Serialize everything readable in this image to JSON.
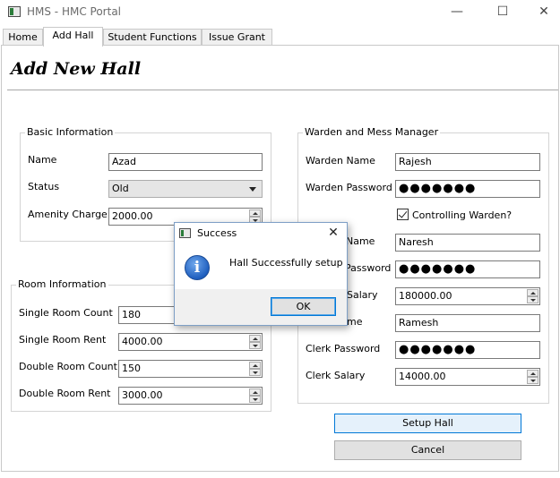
{
  "window": {
    "title": "HMS - HMC Portal",
    "icon": "app-window-icon",
    "minimize_glyph": "—",
    "maximize_glyph": "☐",
    "close_glyph": "✕"
  },
  "tabs": [
    {
      "label": "Home",
      "active": false
    },
    {
      "label": "Add Hall",
      "active": true
    },
    {
      "label": "Student Functions",
      "active": false
    },
    {
      "label": "Issue Grant",
      "active": false
    }
  ],
  "page": {
    "title": "Add New Hall"
  },
  "basic_info": {
    "title": "Basic Information",
    "name_label": "Name",
    "name_value": "Azad",
    "status_label": "Status",
    "status_value": "Old",
    "amenity_label": "Amenity Charge",
    "amenity_value": "2000.00"
  },
  "room_info": {
    "title": "Room Information",
    "single_count_label": "Single Room Count",
    "single_count_value": "180",
    "single_rent_label": "Single Room Rent",
    "single_rent_value": "4000.00",
    "double_count_label": "Double Room Count",
    "double_count_value": "150",
    "double_rent_label": "Double Room Rent",
    "double_rent_value": "3000.00"
  },
  "warden_info": {
    "title": "Warden and Mess Manager",
    "warden_name_label": "Warden Name",
    "warden_name_value": "Rajesh",
    "warden_password_label": "Warden Password",
    "warden_password_value": "●●●●●●●",
    "controlling_label": "Controlling Warden?",
    "controlling_checked": true,
    "mess_name_label": "Name",
    "mess_name_value": "Naresh",
    "mess_password_label": "Password",
    "mess_password_value": "●●●●●●●",
    "mess_salary_label": "Salary",
    "mess_salary_value": "180000.00",
    "clerk_name_label": "me",
    "clerk_name_value": "Ramesh",
    "clerk_password_label": "Clerk Password",
    "clerk_password_value": "●●●●●●●",
    "clerk_salary_label": "Clerk Salary",
    "clerk_salary_value": "14000.00"
  },
  "actions": {
    "setup_label": "Setup Hall",
    "cancel_label": "Cancel"
  },
  "dialog": {
    "title": "Success",
    "message": "Hall Successfully setup",
    "ok_label": "OK",
    "icon": "info-icon",
    "icon_glyph": "i",
    "close_glyph": "✕"
  }
}
